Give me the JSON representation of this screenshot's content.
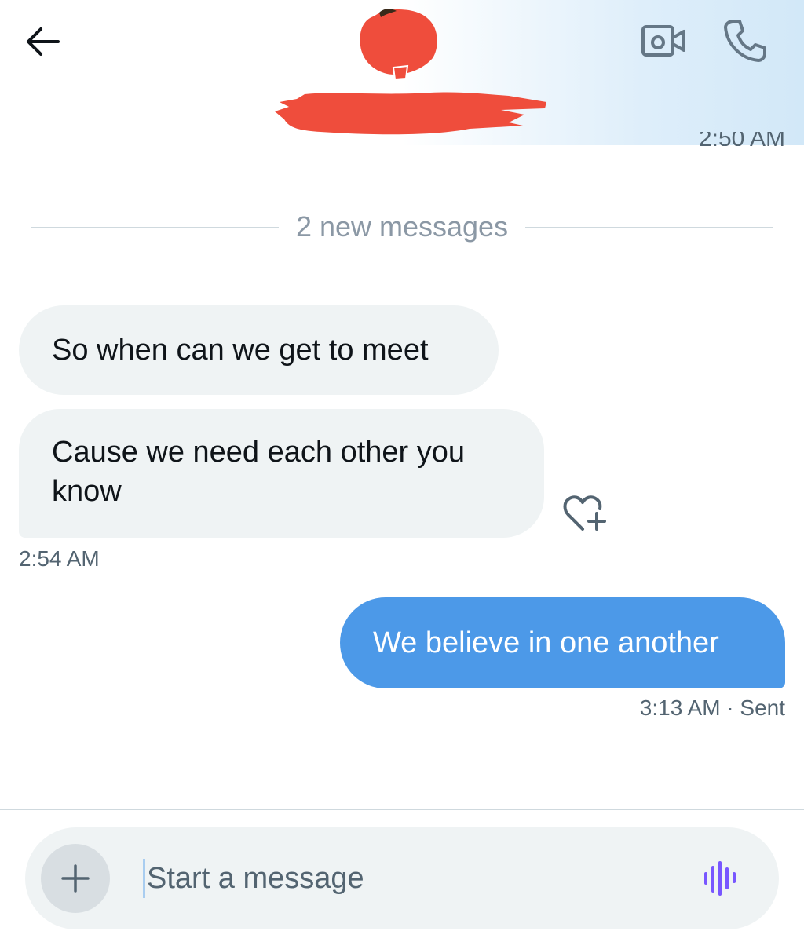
{
  "header": {
    "back_icon": "arrow-left-icon",
    "video_icon": "video-camera-icon",
    "call_icon": "phone-icon",
    "redaction_color": "#ef4d3c"
  },
  "messages": {
    "previous_time": "2:50 AM",
    "new_divider": "2 new messages",
    "incoming": [
      {
        "text": "So when can we get to meet"
      },
      {
        "text": "Cause we need each other you know"
      }
    ],
    "incoming_time": "2:54 AM",
    "outgoing": [
      {
        "text": "We believe in one another"
      }
    ],
    "outgoing_time": "3:13 AM",
    "outgoing_status": "· Sent"
  },
  "composer": {
    "placeholder": "Start a message",
    "add_icon": "plus-icon",
    "voice_icon": "voice-wave-icon",
    "accent": "#7856ff"
  },
  "colors": {
    "outgoing_bubble": "#4c99e8",
    "incoming_bubble": "#eff3f4"
  }
}
